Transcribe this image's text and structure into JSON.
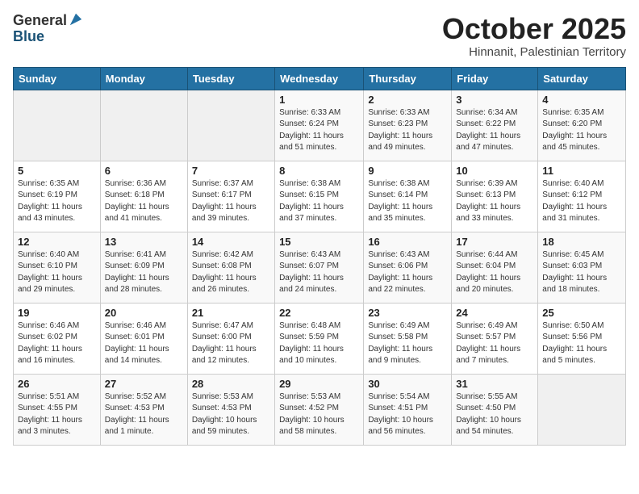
{
  "header": {
    "logo_general": "General",
    "logo_blue": "Blue",
    "month_title": "October 2025",
    "subtitle": "Hinnanit, Palestinian Territory"
  },
  "weekdays": [
    "Sunday",
    "Monday",
    "Tuesday",
    "Wednesday",
    "Thursday",
    "Friday",
    "Saturday"
  ],
  "weeks": [
    [
      {
        "day": "",
        "info": ""
      },
      {
        "day": "",
        "info": ""
      },
      {
        "day": "",
        "info": ""
      },
      {
        "day": "1",
        "info": "Sunrise: 6:33 AM\nSunset: 6:24 PM\nDaylight: 11 hours\nand 51 minutes."
      },
      {
        "day": "2",
        "info": "Sunrise: 6:33 AM\nSunset: 6:23 PM\nDaylight: 11 hours\nand 49 minutes."
      },
      {
        "day": "3",
        "info": "Sunrise: 6:34 AM\nSunset: 6:22 PM\nDaylight: 11 hours\nand 47 minutes."
      },
      {
        "day": "4",
        "info": "Sunrise: 6:35 AM\nSunset: 6:20 PM\nDaylight: 11 hours\nand 45 minutes."
      }
    ],
    [
      {
        "day": "5",
        "info": "Sunrise: 6:35 AM\nSunset: 6:19 PM\nDaylight: 11 hours\nand 43 minutes."
      },
      {
        "day": "6",
        "info": "Sunrise: 6:36 AM\nSunset: 6:18 PM\nDaylight: 11 hours\nand 41 minutes."
      },
      {
        "day": "7",
        "info": "Sunrise: 6:37 AM\nSunset: 6:17 PM\nDaylight: 11 hours\nand 39 minutes."
      },
      {
        "day": "8",
        "info": "Sunrise: 6:38 AM\nSunset: 6:15 PM\nDaylight: 11 hours\nand 37 minutes."
      },
      {
        "day": "9",
        "info": "Sunrise: 6:38 AM\nSunset: 6:14 PM\nDaylight: 11 hours\nand 35 minutes."
      },
      {
        "day": "10",
        "info": "Sunrise: 6:39 AM\nSunset: 6:13 PM\nDaylight: 11 hours\nand 33 minutes."
      },
      {
        "day": "11",
        "info": "Sunrise: 6:40 AM\nSunset: 6:12 PM\nDaylight: 11 hours\nand 31 minutes."
      }
    ],
    [
      {
        "day": "12",
        "info": "Sunrise: 6:40 AM\nSunset: 6:10 PM\nDaylight: 11 hours\nand 29 minutes."
      },
      {
        "day": "13",
        "info": "Sunrise: 6:41 AM\nSunset: 6:09 PM\nDaylight: 11 hours\nand 28 minutes."
      },
      {
        "day": "14",
        "info": "Sunrise: 6:42 AM\nSunset: 6:08 PM\nDaylight: 11 hours\nand 26 minutes."
      },
      {
        "day": "15",
        "info": "Sunrise: 6:43 AM\nSunset: 6:07 PM\nDaylight: 11 hours\nand 24 minutes."
      },
      {
        "day": "16",
        "info": "Sunrise: 6:43 AM\nSunset: 6:06 PM\nDaylight: 11 hours\nand 22 minutes."
      },
      {
        "day": "17",
        "info": "Sunrise: 6:44 AM\nSunset: 6:04 PM\nDaylight: 11 hours\nand 20 minutes."
      },
      {
        "day": "18",
        "info": "Sunrise: 6:45 AM\nSunset: 6:03 PM\nDaylight: 11 hours\nand 18 minutes."
      }
    ],
    [
      {
        "day": "19",
        "info": "Sunrise: 6:46 AM\nSunset: 6:02 PM\nDaylight: 11 hours\nand 16 minutes."
      },
      {
        "day": "20",
        "info": "Sunrise: 6:46 AM\nSunset: 6:01 PM\nDaylight: 11 hours\nand 14 minutes."
      },
      {
        "day": "21",
        "info": "Sunrise: 6:47 AM\nSunset: 6:00 PM\nDaylight: 11 hours\nand 12 minutes."
      },
      {
        "day": "22",
        "info": "Sunrise: 6:48 AM\nSunset: 5:59 PM\nDaylight: 11 hours\nand 10 minutes."
      },
      {
        "day": "23",
        "info": "Sunrise: 6:49 AM\nSunset: 5:58 PM\nDaylight: 11 hours\nand 9 minutes."
      },
      {
        "day": "24",
        "info": "Sunrise: 6:49 AM\nSunset: 5:57 PM\nDaylight: 11 hours\nand 7 minutes."
      },
      {
        "day": "25",
        "info": "Sunrise: 6:50 AM\nSunset: 5:56 PM\nDaylight: 11 hours\nand 5 minutes."
      }
    ],
    [
      {
        "day": "26",
        "info": "Sunrise: 5:51 AM\nSunset: 4:55 PM\nDaylight: 11 hours\nand 3 minutes."
      },
      {
        "day": "27",
        "info": "Sunrise: 5:52 AM\nSunset: 4:53 PM\nDaylight: 11 hours\nand 1 minute."
      },
      {
        "day": "28",
        "info": "Sunrise: 5:53 AM\nSunset: 4:53 PM\nDaylight: 10 hours\nand 59 minutes."
      },
      {
        "day": "29",
        "info": "Sunrise: 5:53 AM\nSunset: 4:52 PM\nDaylight: 10 hours\nand 58 minutes."
      },
      {
        "day": "30",
        "info": "Sunrise: 5:54 AM\nSunset: 4:51 PM\nDaylight: 10 hours\nand 56 minutes."
      },
      {
        "day": "31",
        "info": "Sunrise: 5:55 AM\nSunset: 4:50 PM\nDaylight: 10 hours\nand 54 minutes."
      },
      {
        "day": "",
        "info": ""
      }
    ]
  ]
}
